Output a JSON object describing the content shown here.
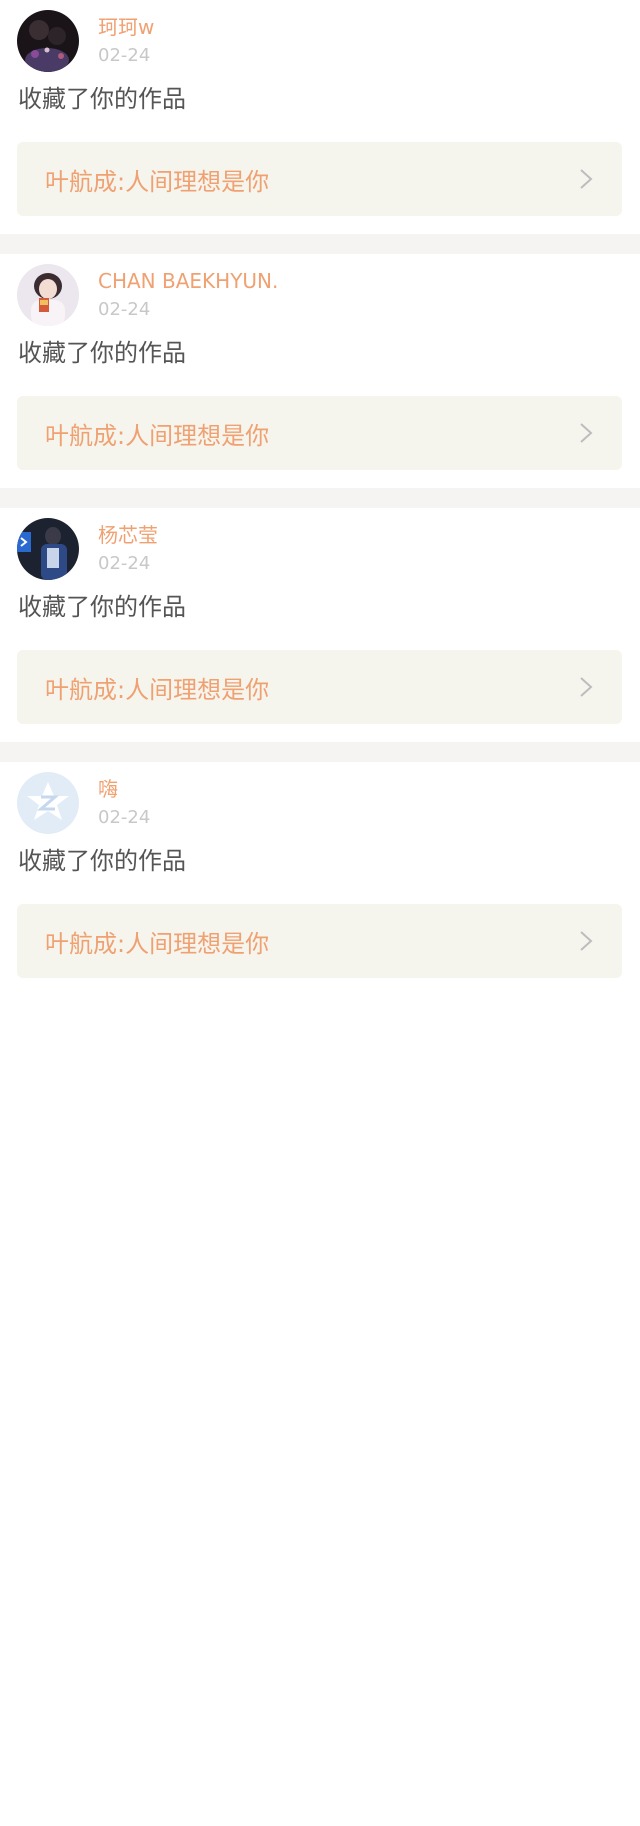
{
  "notifications": [
    {
      "username": "珂珂w",
      "date": "02-24",
      "action": "收藏了你的作品",
      "work_title": "叶航成:人间理想是你",
      "avatar_icon": "dark-photo-avatar"
    },
    {
      "username": "CHAN BAEKHYUN.",
      "date": "02-24",
      "action": "收藏了你的作品",
      "work_title": "叶航成:人间理想是你",
      "avatar_icon": "light-photo-avatar"
    },
    {
      "username": "杨芯莹",
      "date": "02-24",
      "action": "收藏了你的作品",
      "work_title": "叶航成:人间理想是你",
      "avatar_icon": "night-photo-avatar"
    },
    {
      "username": "嗨",
      "date": "02-24",
      "action": "收藏了你的作品",
      "work_title": "叶航成:人间理想是你",
      "avatar_icon": "default-qzone-avatar"
    }
  ],
  "colors": {
    "accent": "#f0a171",
    "date_gray": "#c8c8c8",
    "body_text": "#555555",
    "link_bg": "#f5f5ee",
    "divider_bg": "#f5f4f3"
  }
}
